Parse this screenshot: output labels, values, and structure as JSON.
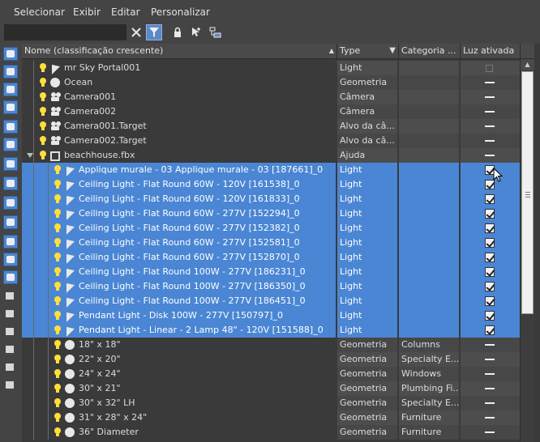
{
  "menu": [
    "Selecionar",
    "Exibir",
    "Editar",
    "Personalizar"
  ],
  "search": {
    "value": "",
    "placeholder": ""
  },
  "toolbar": {
    "clear_icon": "close-icon",
    "filter_icon": "filter-icon",
    "lock_icon": "lock-icon",
    "add_icon": "add-selection-icon",
    "select_icon": "select-children-icon"
  },
  "columns": [
    {
      "label": "Nome (classificação crescente)",
      "sort": "asc"
    },
    {
      "label": "Type"
    },
    {
      "label": "Categoria ..."
    },
    {
      "label": "Luz ativada"
    }
  ],
  "rows": [
    {
      "name": "mr Sky Portal001",
      "type": "Light",
      "category": "",
      "icon": "spot",
      "check": "empty",
      "indent": 0,
      "selected": false
    },
    {
      "name": "Ocean",
      "type": "Geometria",
      "category": "",
      "icon": "sphere",
      "check": "dash",
      "indent": 0,
      "selected": false
    },
    {
      "name": "Camera001",
      "type": "Câmera",
      "category": "",
      "icon": "cam",
      "check": "dash",
      "indent": 0,
      "selected": false
    },
    {
      "name": "Camera002",
      "type": "Câmera",
      "category": "",
      "icon": "cam",
      "check": "dash",
      "indent": 0,
      "selected": false
    },
    {
      "name": "Camera001.Target",
      "type": "Alvo da câ...",
      "category": "",
      "icon": "cam",
      "check": "dash",
      "indent": 0,
      "selected": false
    },
    {
      "name": "Camera002.Target",
      "type": "Alvo da câ...",
      "category": "",
      "icon": "cam",
      "check": "dash",
      "indent": 0,
      "selected": false
    },
    {
      "name": "beachhouse.fbx",
      "type": "Ajuda",
      "category": "",
      "icon": "helper",
      "check": "dash",
      "indent": 0,
      "selected": false,
      "expanded": true
    },
    {
      "name": "Applique murale - 03 Applique murale - 03 [187661]_0",
      "type": "Light",
      "category": "",
      "icon": "spot",
      "check": "checked",
      "indent": 1,
      "selected": true
    },
    {
      "name": "Ceiling Light - Flat Round 60W - 120V [161538]_0",
      "type": "Light",
      "category": "",
      "icon": "spot",
      "check": "checked",
      "indent": 1,
      "selected": true
    },
    {
      "name": "Ceiling Light - Flat Round 60W - 120V [161833]_0",
      "type": "Light",
      "category": "",
      "icon": "spot",
      "check": "checked",
      "indent": 1,
      "selected": true
    },
    {
      "name": "Ceiling Light - Flat Round 60W - 277V [152294]_0",
      "type": "Light",
      "category": "",
      "icon": "spot",
      "check": "checked",
      "indent": 1,
      "selected": true
    },
    {
      "name": "Ceiling Light - Flat Round 60W - 277V [152382]_0",
      "type": "Light",
      "category": "",
      "icon": "spot",
      "check": "checked",
      "indent": 1,
      "selected": true
    },
    {
      "name": "Ceiling Light - Flat Round 60W - 277V [152581]_0",
      "type": "Light",
      "category": "",
      "icon": "spot",
      "check": "checked",
      "indent": 1,
      "selected": true
    },
    {
      "name": "Ceiling Light - Flat Round 60W - 277V [152870]_0",
      "type": "Light",
      "category": "",
      "icon": "spot",
      "check": "checked",
      "indent": 1,
      "selected": true
    },
    {
      "name": "Ceiling Light - Flat Round 100W - 277V [186231]_0",
      "type": "Light",
      "category": "",
      "icon": "spot",
      "check": "checked",
      "indent": 1,
      "selected": true
    },
    {
      "name": "Ceiling Light - Flat Round 100W - 277V [186350]_0",
      "type": "Light",
      "category": "",
      "icon": "spot",
      "check": "checked",
      "indent": 1,
      "selected": true
    },
    {
      "name": "Ceiling Light - Flat Round 100W - 277V [186451]_0",
      "type": "Light",
      "category": "",
      "icon": "spot",
      "check": "checked",
      "indent": 1,
      "selected": true
    },
    {
      "name": "Pendant Light - Disk 100W - 277V [150797]_0",
      "type": "Light",
      "category": "",
      "icon": "spot",
      "check": "checked",
      "indent": 1,
      "selected": true
    },
    {
      "name": "Pendant Light - Linear - 2 Lamp 48\" - 120V [151588]_0",
      "type": "Light",
      "category": "",
      "icon": "spot",
      "check": "checked",
      "indent": 1,
      "selected": true
    },
    {
      "name": "18\" x 18\"",
      "type": "Geometria",
      "category": "Columns",
      "icon": "sphere",
      "check": "dash",
      "indent": 1,
      "selected": false
    },
    {
      "name": "22\" x 20\"",
      "type": "Geometria",
      "category": "Specialty E...",
      "icon": "sphere",
      "check": "dash",
      "indent": 1,
      "selected": false
    },
    {
      "name": "24\" x 24\"",
      "type": "Geometria",
      "category": "Windows",
      "icon": "sphere",
      "check": "dash",
      "indent": 1,
      "selected": false
    },
    {
      "name": "30\" x 21\"",
      "type": "Geometria",
      "category": "Plumbing Fi...",
      "icon": "sphere",
      "check": "dash",
      "indent": 1,
      "selected": false
    },
    {
      "name": "30\" x 32\" LH",
      "type": "Geometria",
      "category": "Specialty E...",
      "icon": "sphere",
      "check": "dash",
      "indent": 1,
      "selected": false
    },
    {
      "name": "31\" x 28\" x 24\"",
      "type": "Geometria",
      "category": "Furniture",
      "icon": "sphere",
      "check": "dash",
      "indent": 1,
      "selected": false
    },
    {
      "name": "36\" Diameter",
      "type": "Geometria",
      "category": "Furniture",
      "icon": "sphere",
      "check": "dash",
      "indent": 1,
      "selected": false
    }
  ],
  "left_tools": [
    "display-all-icon",
    "geometry-icon",
    "shapes-icon",
    "lights-icon",
    "cameras-icon",
    "helpers-icon",
    "spacewarps-icon",
    "groups-icon",
    "xrefs-icon",
    "bones-icon",
    "containers-icon",
    "frozen-icon",
    "hidden-icon",
    "list-icon",
    "page-icon",
    "layers-icon",
    "filter-icon",
    "hierarchy-icon",
    "collapse-icon"
  ]
}
